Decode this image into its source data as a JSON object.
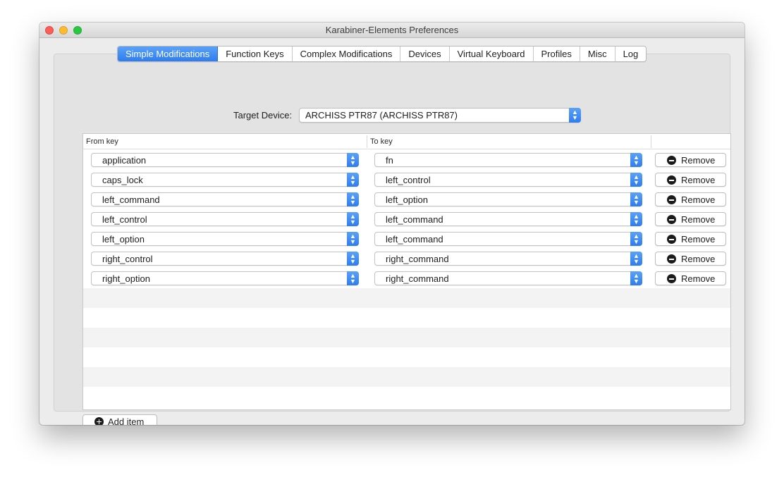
{
  "window": {
    "title": "Karabiner-Elements Preferences"
  },
  "tabs": [
    {
      "label": "Simple Modifications",
      "active": true
    },
    {
      "label": "Function Keys",
      "active": false
    },
    {
      "label": "Complex Modifications",
      "active": false
    },
    {
      "label": "Devices",
      "active": false
    },
    {
      "label": "Virtual Keyboard",
      "active": false
    },
    {
      "label": "Profiles",
      "active": false
    },
    {
      "label": "Misc",
      "active": false
    },
    {
      "label": "Log",
      "active": false
    }
  ],
  "target_device": {
    "label": "Target Device:",
    "value": "ARCHISS PTR87 (ARCHISS PTR87)"
  },
  "table": {
    "columns": {
      "from": "From key",
      "to": "To key"
    },
    "rows": [
      {
        "from": "application",
        "to": "fn",
        "remove": "Remove"
      },
      {
        "from": "caps_lock",
        "to": "left_control",
        "remove": "Remove"
      },
      {
        "from": "left_command",
        "to": "left_option",
        "remove": "Remove"
      },
      {
        "from": "left_control",
        "to": "left_command",
        "remove": "Remove"
      },
      {
        "from": "left_option",
        "to": "left_command",
        "remove": "Remove"
      },
      {
        "from": "right_control",
        "to": "right_command",
        "remove": "Remove"
      },
      {
        "from": "right_option",
        "to": "right_command",
        "remove": "Remove"
      }
    ]
  },
  "add_item": {
    "label": "Add item"
  },
  "icons": {
    "close": "close-dot",
    "minimize": "minimize-dot",
    "zoom": "zoom-dot",
    "stepper": "up-down-chevron-icon",
    "remove": "minus-circle-icon",
    "add": "plus-circle-icon"
  },
  "colors": {
    "accent": "#2f7cf0",
    "close": "#fc5f57",
    "minimize": "#fdbc2e",
    "zoom": "#28c840"
  }
}
